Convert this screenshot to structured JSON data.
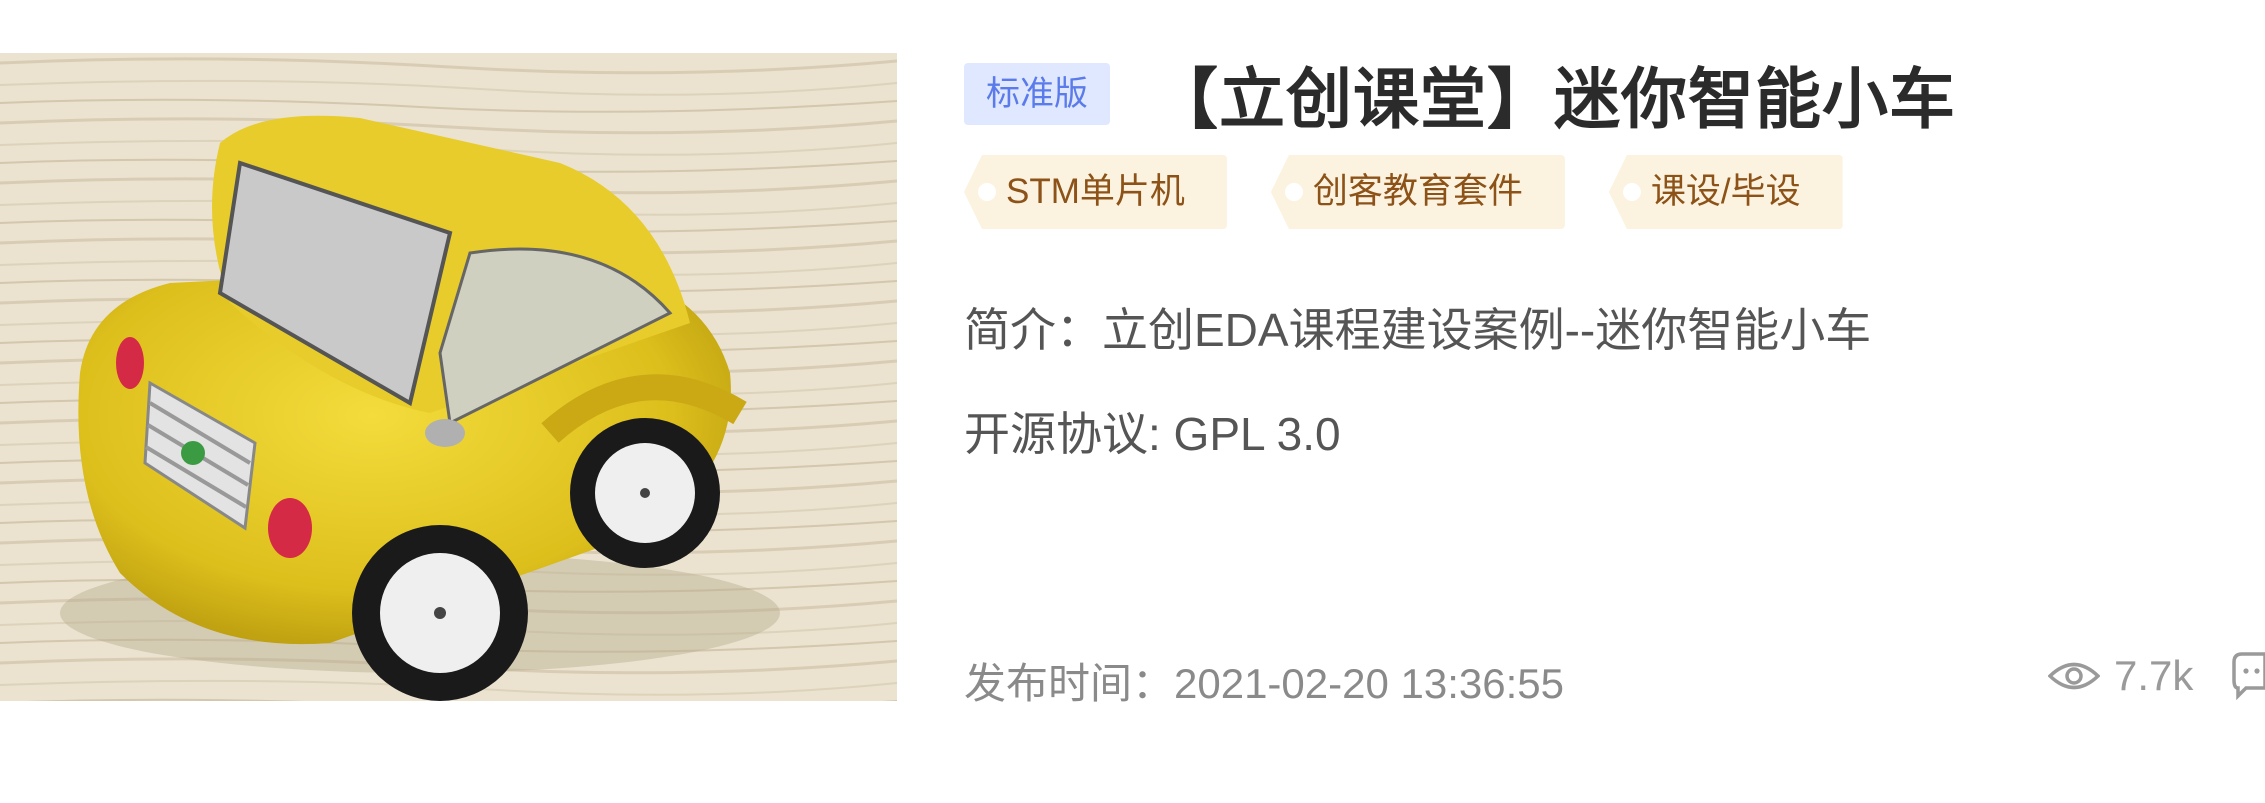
{
  "project": {
    "thumbnail_alt": "yellow mini smart car",
    "edition_badge": "标准版",
    "title": "【立创课堂】迷你智能小车",
    "tags": [
      "STM单片机",
      "创客教育套件",
      "课设/毕设"
    ],
    "summary": "简介：立创EDA课程建设案例--迷你智能小车",
    "license": "开源协议: GPL 3.0",
    "publish_time": "发布时间：2021-02-20 13:36:55",
    "views": "7.7k"
  },
  "colors": {
    "badge_bg": "#e0e8ff",
    "badge_text": "#5b7bea",
    "tag_bg": "#fbf3df",
    "tag_text": "#8c5218",
    "title_text": "#2b2b2b"
  },
  "icons": [
    "eye-icon",
    "comment-icon"
  ]
}
